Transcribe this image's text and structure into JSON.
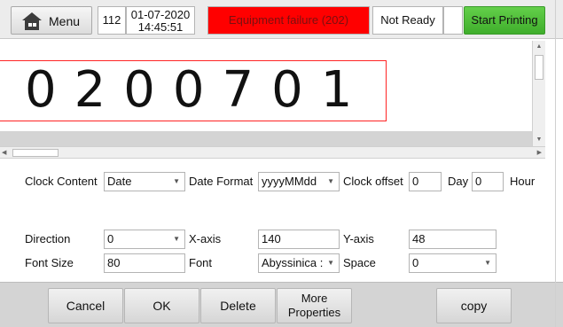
{
  "topbar": {
    "menu_label": "Menu",
    "counter": "112",
    "date": "01-07-2020",
    "time": "14:45:51",
    "alarm": "Equipment failure (202)",
    "status": "Not Ready",
    "start_label": "Start Printing"
  },
  "preview": {
    "text": "0200701"
  },
  "clock": {
    "content_label": "Clock Content",
    "content_value": "Date",
    "format_label": "Date Format",
    "format_value": "yyyyMMdd",
    "offset_label": "Clock offset",
    "offset_day_value": "0",
    "day_label": "Day",
    "offset_hour_value": "0",
    "hour_label": "Hour"
  },
  "props": {
    "direction_label": "Direction",
    "direction_value": "0",
    "xaxis_label": "X-axis",
    "xaxis_value": "140",
    "yaxis_label": "Y-axis",
    "yaxis_value": "48",
    "fontsize_label": "Font Size",
    "fontsize_value": "80",
    "font_label": "Font",
    "font_value": "Abyssinica :",
    "space_label": "Space",
    "space_value": "0"
  },
  "buttons": {
    "cancel": "Cancel",
    "ok": "OK",
    "delete": "Delete",
    "more_line1": "More",
    "more_line2": "Properties",
    "copy": "copy"
  },
  "colors": {
    "alarm_bg": "#ff0000",
    "start_bg": "#4cbf36",
    "preview_border": "#ff2424"
  },
  "icons": {
    "menu": "home-icon",
    "dropdown": "chevron-down-icon"
  }
}
